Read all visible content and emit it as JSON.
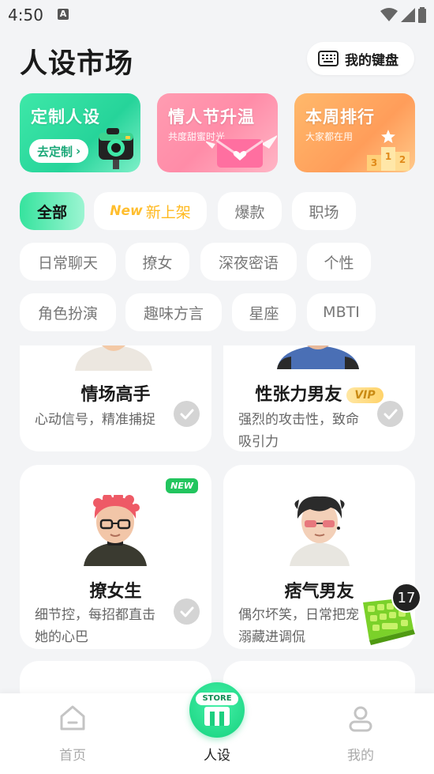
{
  "status_bar": {
    "time": "4:50",
    "notification_icon": "A"
  },
  "header": {
    "title": "人设市场",
    "keyboard_button_label": "我的键盘"
  },
  "banners": [
    {
      "title": "定制人设",
      "button_label": "去定制"
    },
    {
      "title": "情人节升温",
      "subtitle": "共度甜蜜时光"
    },
    {
      "title": "本周排行",
      "subtitle": "大家都在用"
    }
  ],
  "categories": {
    "all": "全部",
    "new_tag": "New",
    "new_label": "新上架",
    "items": [
      "爆款",
      "职场",
      "日常聊天",
      "撩女",
      "深夜密语",
      "个性",
      "角色扮演",
      "趣味方言",
      "星座",
      "MBTI"
    ]
  },
  "cards": [
    {
      "name": "情场高手",
      "desc": "心动信号，精准捕捉"
    },
    {
      "name": "性张力男友",
      "badge": "VIP",
      "desc": "强烈的攻击性，致命吸引力"
    },
    {
      "name": "撩女生",
      "badge": "NEW",
      "desc": "细节控，每招都直击她的心巴"
    },
    {
      "name": "痞气男友",
      "desc": "偶尔坏笑，日常把宠溺藏进调侃"
    }
  ],
  "floating": {
    "count": "17"
  },
  "bottom_nav": {
    "home": "首页",
    "persona": "人设",
    "mine": "我的",
    "store_tag": "STORE"
  },
  "colors": {
    "accent": "#22d48c",
    "vip": "#ffd36a",
    "new_orange": "#ffb91e"
  }
}
